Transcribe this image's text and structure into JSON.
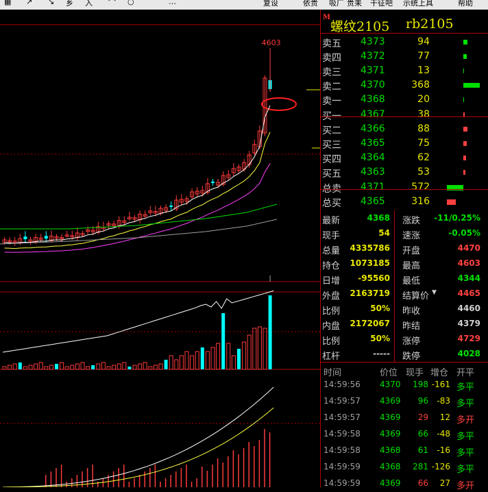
{
  "menubar": {
    "items": [
      "▦",
      "↗",
      "↘",
      "乡",
      "入",
      "⌒",
      "○",
      "…",
      "复设",
      "依贵",
      "吸厂",
      "贵耒",
      "干征吧",
      "示统上具",
      "帮助"
    ]
  },
  "chart": {
    "peak_label": "4603",
    "colors": {
      "up": "#ff3b3b",
      "down": "#00ffff",
      "ma1": "#ffffff",
      "ma2": "#ffff40",
      "ma3": "#ff40ff",
      "ma4": "#00e000",
      "ma5": "#a0a0a0"
    }
  },
  "quote": {
    "flag": "M",
    "name": "螺纹2105",
    "code": "rb2105",
    "asks": [
      {
        "label": "卖五",
        "price": "4373",
        "vol": "94",
        "bar": 94
      },
      {
        "label": "卖四",
        "price": "4372",
        "vol": "77",
        "bar": 77
      },
      {
        "label": "卖三",
        "price": "4371",
        "vol": "13",
        "bar": 13
      },
      {
        "label": "卖二",
        "price": "4370",
        "vol": "368",
        "bar": 368
      },
      {
        "label": "卖一",
        "price": "4368",
        "vol": "20",
        "bar": 20
      }
    ],
    "bids": [
      {
        "label": "买一",
        "price": "4367",
        "vol": "38",
        "bar": 38
      },
      {
        "label": "买二",
        "price": "4366",
        "vol": "88",
        "bar": 88
      },
      {
        "label": "买三",
        "price": "4365",
        "vol": "75",
        "bar": 75
      },
      {
        "label": "买四",
        "price": "4364",
        "vol": "62",
        "bar": 62
      },
      {
        "label": "买五",
        "price": "4363",
        "vol": "53",
        "bar": 53
      }
    ],
    "totals": [
      {
        "label": "总卖",
        "price": "4371",
        "vol": "572",
        "bar": 572,
        "color": "#00e000"
      },
      {
        "label": "总买",
        "price": "4365",
        "vol": "316",
        "bar": 316,
        "color": "#ff4040"
      }
    ],
    "stats": [
      {
        "l1": "最新",
        "v1": "4368",
        "c1": "g",
        "l2": "涨跌",
        "v2": "-11/0.25%",
        "c2": "g"
      },
      {
        "l1": "现手",
        "v1": "54",
        "c1": "y",
        "l2": "速涨",
        "v2": "-0.05%",
        "c2": "g"
      },
      {
        "l1": "总量",
        "v1": "4335786",
        "c1": "y",
        "l2": "开盘",
        "v2": "4470",
        "c2": "r"
      },
      {
        "l1": "持仓",
        "v1": "1073185",
        "c1": "y",
        "l2": "最高",
        "v2": "4603",
        "c2": "r"
      },
      {
        "l1": "日增",
        "v1": "-95560",
        "c1": "y",
        "l2": "最低",
        "v2": "4344",
        "c2": "g"
      },
      {
        "l1": "外盘",
        "v1": "2163719",
        "c1": "y",
        "l2": "结算价",
        "v2": "4465",
        "c2": "r"
      },
      {
        "l1": "比例",
        "v1": "50%",
        "c1": "y",
        "l2": "昨收",
        "v2": "4460",
        "c2": "w"
      },
      {
        "l1": "内盘",
        "v1": "2172067",
        "c1": "y",
        "l2": "昨结",
        "v2": "4379",
        "c2": "w"
      },
      {
        "l1": "比例",
        "v1": "50%",
        "c1": "y",
        "l2": "涨停",
        "v2": "4729",
        "c2": "r"
      },
      {
        "l1": "杠杆",
        "v1": "-----",
        "c1": "w",
        "l2": "跌停",
        "v2": "4028",
        "c2": "g"
      }
    ],
    "tick_headers": [
      "时间",
      "价位",
      "现手",
      "增仓",
      "开平"
    ],
    "ticks": [
      {
        "time": "14:59:56",
        "price": "4370",
        "vol": "198",
        "chg": "-161",
        "type": "多平",
        "vc": "g"
      },
      {
        "time": "14:59:57",
        "price": "4369",
        "vol": "96",
        "chg": "-83",
        "type": "多平",
        "vc": "g"
      },
      {
        "time": "14:59:57",
        "price": "4369",
        "vol": "29",
        "chg": "12",
        "type": "多开",
        "vc": "r"
      },
      {
        "time": "14:59:58",
        "price": "4369",
        "vol": "66",
        "chg": "-48",
        "type": "多平",
        "vc": "g"
      },
      {
        "time": "14:59:58",
        "price": "4368",
        "vol": "61",
        "chg": "-16",
        "type": "多平",
        "vc": "g"
      },
      {
        "time": "14:59:59",
        "price": "4368",
        "vol": "281",
        "chg": "-126",
        "type": "多平",
        "vc": "g"
      },
      {
        "time": "14:59:59",
        "price": "4369",
        "vol": "66",
        "chg": "27",
        "type": "多开",
        "vc": "r"
      }
    ]
  }
}
